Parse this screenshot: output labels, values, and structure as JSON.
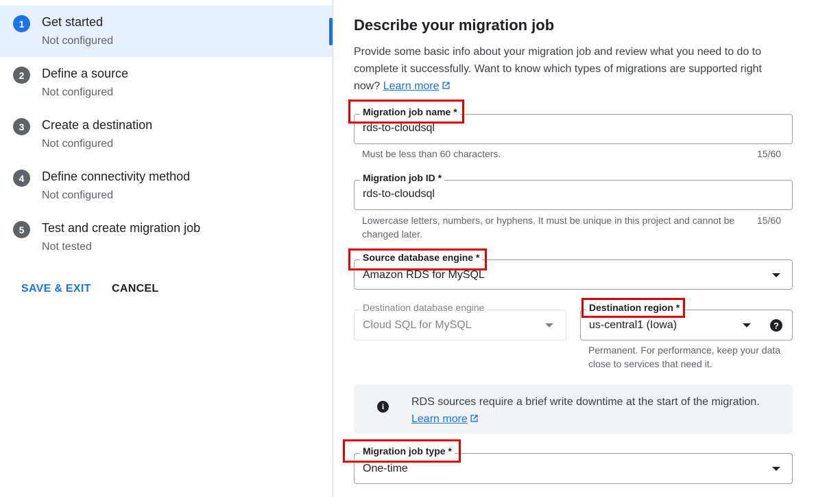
{
  "sidebar": {
    "steps": [
      {
        "number": "1",
        "title": "Get started",
        "status": "Not configured",
        "active": true
      },
      {
        "number": "2",
        "title": "Define a source",
        "status": "Not configured"
      },
      {
        "number": "3",
        "title": "Create a destination",
        "status": "Not configured"
      },
      {
        "number": "4",
        "title": "Define connectivity method",
        "status": "Not configured"
      },
      {
        "number": "5",
        "title": "Test and create migration job",
        "status": "Not tested"
      }
    ],
    "save_exit_label": "SAVE & EXIT",
    "cancel_label": "CANCEL"
  },
  "main": {
    "heading": "Describe your migration job",
    "intro_text": "Provide some basic info about your migration job and review what you need to do to complete it successfully. Want to know which types of migrations are supported right now?",
    "intro_link": "Learn more",
    "job_name": {
      "label": "Migration job name *",
      "value": "rds-to-cloudsql",
      "hint": "Must be less than 60 characters.",
      "counter": "15/60"
    },
    "job_id": {
      "label": "Migration job ID *",
      "value": "rds-to-cloudsql",
      "hint": "Lowercase letters, numbers, or hyphens. It must be unique in this project and cannot be changed later.",
      "counter": "15/60"
    },
    "source_engine": {
      "label": "Source database engine *",
      "value": "Amazon RDS for MySQL"
    },
    "destination_engine": {
      "label": "Destination database engine",
      "value": "Cloud SQL for MySQL"
    },
    "destination_region": {
      "label": "Destination region *",
      "value": "us-central1 (Iowa)",
      "hint": "Permanent. For performance, keep your data close to services that need it."
    },
    "notice": {
      "text": "RDS sources require a brief write downtime at the start of the migration.",
      "link": "Learn more"
    },
    "job_type": {
      "label": "Migration job type *",
      "value": "One-time"
    }
  },
  "colors": {
    "accent": "#1a73e8",
    "highlight_box": "#e00000",
    "active_step_bg": "#e8f0fe"
  }
}
